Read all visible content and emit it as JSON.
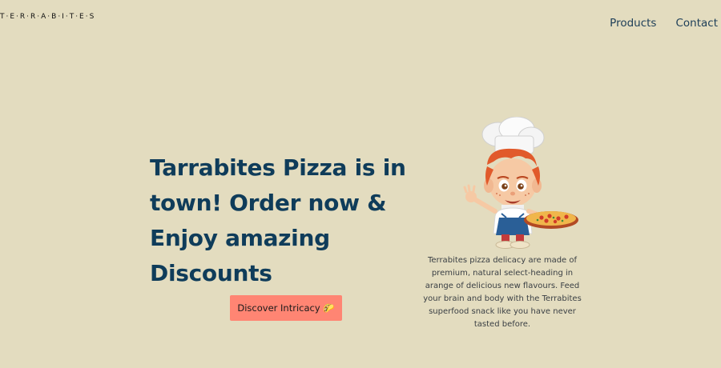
{
  "header": {
    "logo": "T·E·R·R·A·B·I·T·E·S"
  },
  "nav": {
    "items": [
      "Products",
      "Contact"
    ]
  },
  "hero": {
    "headline": "Tarrabites Pizza is in town! Order now & Enjoy amazing Discounts",
    "cta_label": "Discover Intricacy 🌮",
    "description": "Terrabites pizza delicacy are made of premium, natural select-heading in arange of delicious new flavours. Feed your brain and body with the Terrabites superfood snack like you have never tasted before."
  },
  "colors": {
    "background": "#e3dcbf",
    "headline": "#0f3c5a",
    "cta_background": "#ff8573"
  },
  "icons": {
    "chef_illustration": "chef-illustration",
    "taco": "taco-icon"
  }
}
